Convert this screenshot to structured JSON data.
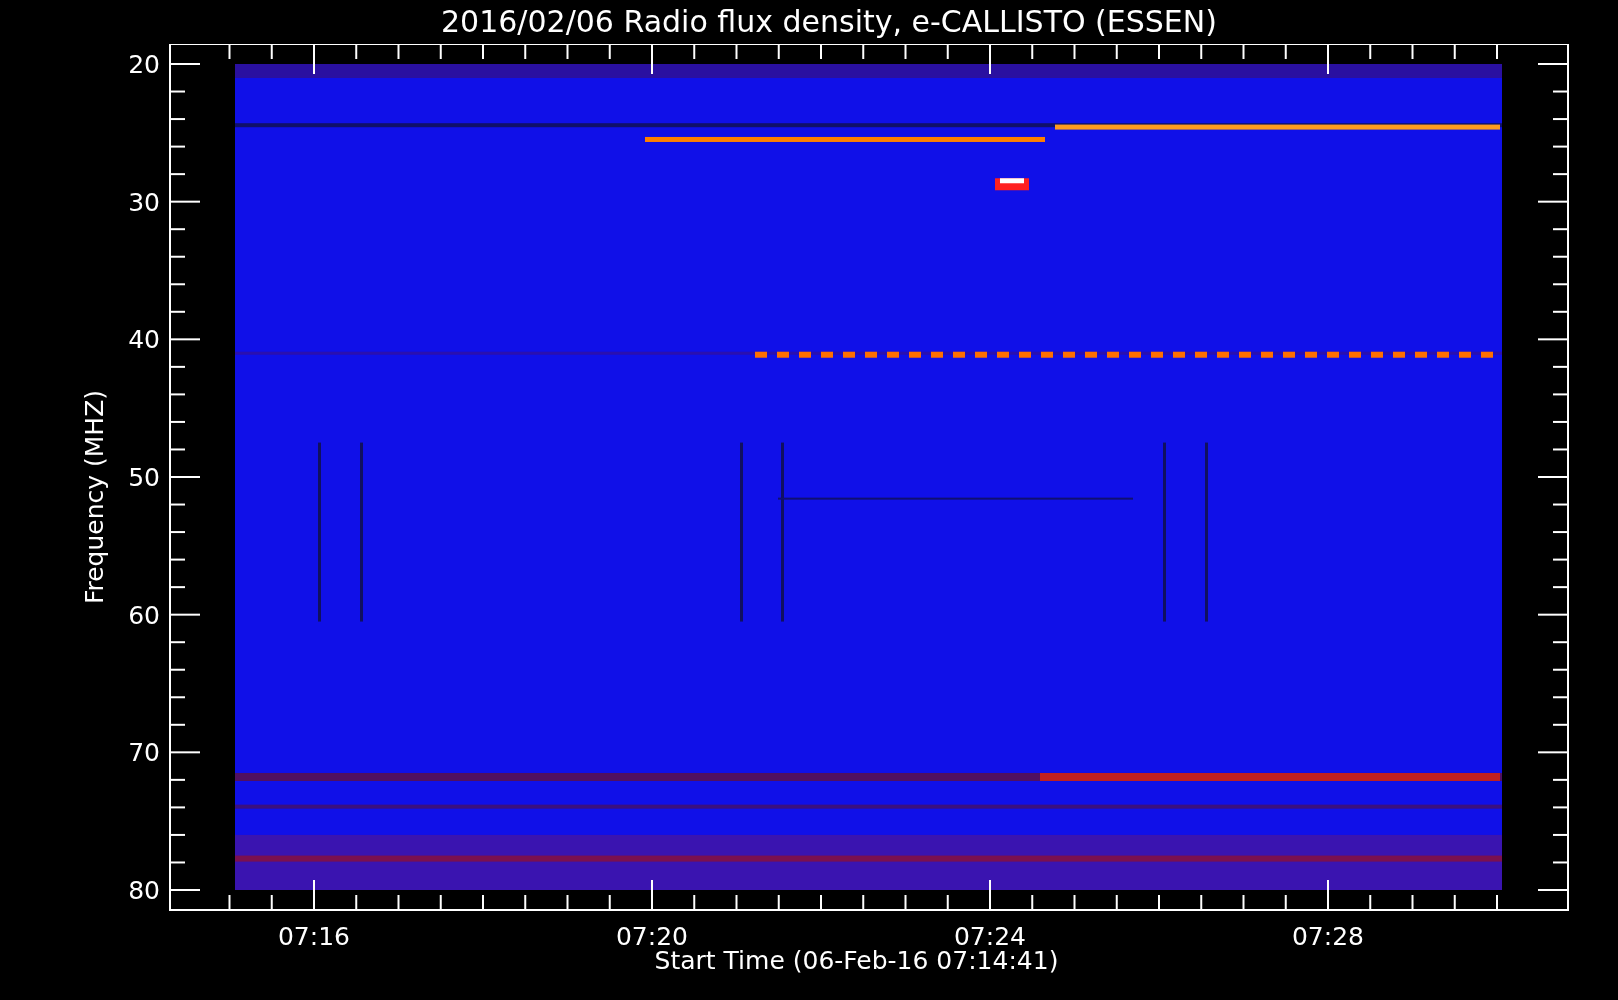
{
  "title": "2016/02/06  Radio flux density, e-CALLISTO (ESSEN)",
  "chart": {
    "ylabel": "Frequency (MHZ)",
    "xlabel": "Start Time (06-Feb-16 07:14:41)",
    "yticks": [
      "20",
      "30",
      "40",
      "50",
      "60",
      "70",
      "80"
    ],
    "xticks": [
      "07:16",
      "07:20",
      "07:24",
      "07:28"
    ]
  }
}
